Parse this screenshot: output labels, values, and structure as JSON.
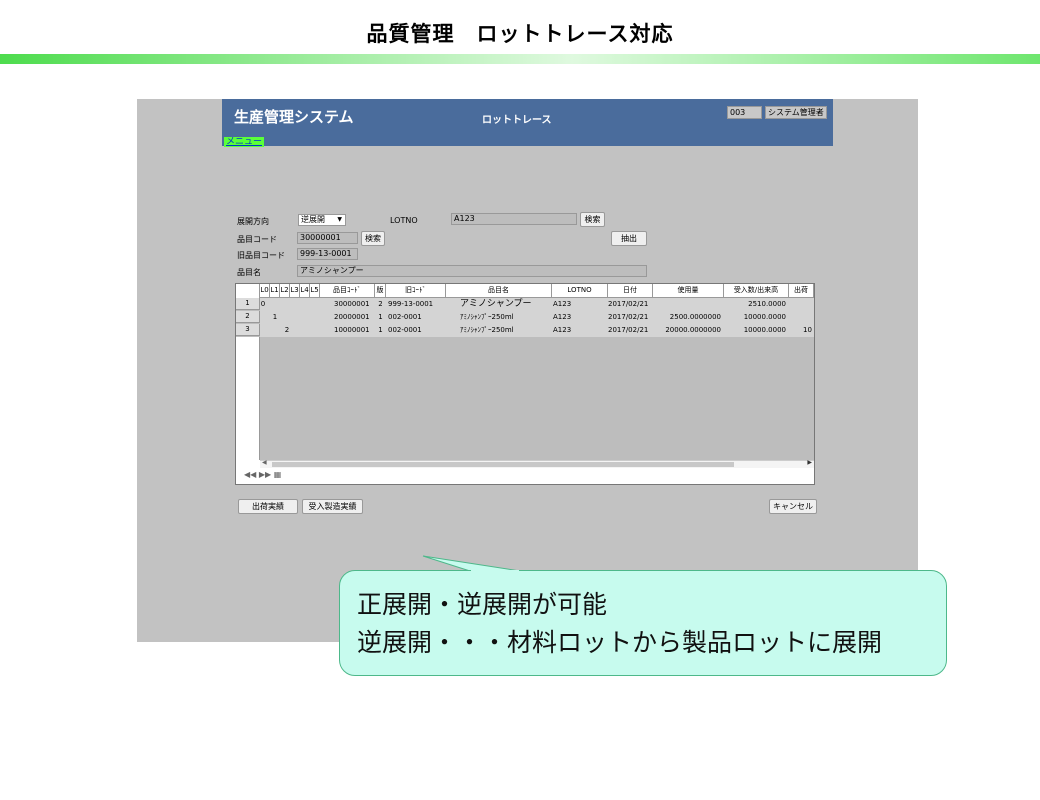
{
  "slide": {
    "title": "品質管理　ロットトレース対応"
  },
  "app": {
    "title": "生産管理システム",
    "screen_name": "ロットトレース",
    "user_code": "003",
    "user_name": "システム管理者",
    "menu_link": "メニュー"
  },
  "form": {
    "direction_label": "展開方向",
    "direction_value": "逆展開",
    "lotno_label": "LOTNO",
    "lotno_value": "A123",
    "lot_search_button": "検索",
    "item_code_label": "品目コード",
    "item_code_value": "30000001",
    "item_search_button": "検索",
    "extract_button": "抽出",
    "old_code_label": "旧品目コード",
    "old_code_value": "999-13-0001",
    "item_name_label": "品目名",
    "item_name_value": "アミノシャンプー"
  },
  "grid": {
    "columns": [
      "L0",
      "L1",
      "L2",
      "L3",
      "L4",
      "L5",
      "品目ｺｰﾄﾞ",
      "版",
      "旧ｺｰﾄﾞ",
      "品目名",
      "LOTNO",
      "日付",
      "使用量",
      "受入数/出来高",
      "出荷"
    ],
    "rows": [
      {
        "no": "1",
        "l0": "0",
        "l1": "",
        "l2": "",
        "code": "30000001",
        "ver": "2",
        "old": "999-13-0001",
        "name": "アミノシャンプー",
        "lot": "A123",
        "date": "2017/02/21",
        "usage": "",
        "qty": "2510.0000",
        "ship": ""
      },
      {
        "no": "2",
        "l0": "",
        "l1": "1",
        "l2": "",
        "code": "20000001",
        "ver": "1",
        "old": "002-0001",
        "name": "ｱﾐﾉｼｬﾝﾌﾟｰ250ml",
        "lot": "A123",
        "date": "2017/02/21",
        "usage": "2500.0000000",
        "qty": "10000.0000",
        "ship": ""
      },
      {
        "no": "3",
        "l0": "",
        "l1": "",
        "l2": "2",
        "code": "10000001",
        "ver": "1",
        "old": "002-0001",
        "name": "ｱﾐﾉｼｬﾝﾌﾟｰ250ml",
        "lot": "A123",
        "date": "2017/02/21",
        "usage": "20000.0000000",
        "qty": "10000.0000",
        "ship": "10"
      }
    ]
  },
  "buttons": {
    "shipment": "出荷実績",
    "receipt_mfg": "受入製造実績",
    "cancel": "キャンセル"
  },
  "callout": {
    "line1": "正展開・逆展開が可能",
    "line2": "逆展開・・・材料ロットから製品ロットに展開"
  },
  "colors": {
    "header_blue": "#4a6c9c",
    "screen_gray": "#c2c2c2",
    "menu_green": "#5aff3a",
    "callout_fill": "#c7fbee",
    "title_bar_green": "#4ddc4d"
  },
  "icons": [
    "first-page-icon",
    "next-page-icon",
    "print-icon"
  ]
}
